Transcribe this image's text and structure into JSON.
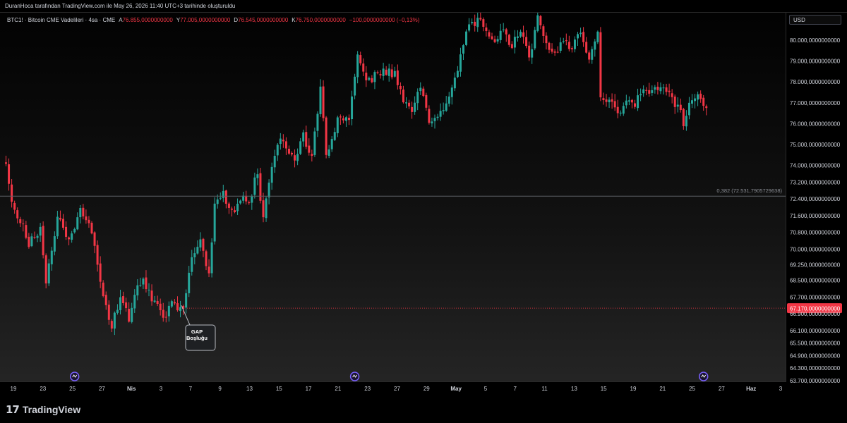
{
  "attribution": "DuranHoca tarafından TradingView.com ile May 26, 2026 11:40 UTC+3 tarihinde oluşturuldu",
  "legend": {
    "symbol": "BTC1! · Bitcoin CME Vadelileri · 4sa · CME",
    "o_label": "A",
    "o_value": "76.855,0000000000",
    "h_label": "Y",
    "h_value": "77.005,0000000000",
    "l_label": "D",
    "l_value": "76.545,0000000000",
    "c_label": "K",
    "c_value": "76.750,0000000000",
    "change": "−100,0000000000 (−0,13%)"
  },
  "currency": "USD",
  "branding": {
    "mark": "17",
    "name": "TradingView"
  },
  "colors": {
    "up": "#26a69a",
    "down": "#f23645",
    "text": "#d1d4dc",
    "fib_line": "#5d6066",
    "price_badge": "#f23645",
    "event_icon": "#7b61ff"
  },
  "chart_data": {
    "type": "candlestick",
    "ylim": [
      63700,
      80400
    ],
    "price_ticks": [
      {
        "value": 80000,
        "label": "80.000,0000000000"
      },
      {
        "value": 79000,
        "label": "79.000,0000000000"
      },
      {
        "value": 78000,
        "label": "78.000,0000000000"
      },
      {
        "value": 77000,
        "label": "77.000,0000000000"
      },
      {
        "value": 76000,
        "label": "76.000,0000000000"
      },
      {
        "value": 75000,
        "label": "75.000,0000000000"
      },
      {
        "value": 74000,
        "label": "74.000,0000000000"
      },
      {
        "value": 73200,
        "label": "73.200,0000000000"
      },
      {
        "value": 72400,
        "label": "72.400,0000000000"
      },
      {
        "value": 71600,
        "label": "71.600,0000000000"
      },
      {
        "value": 70800,
        "label": "70.800,0000000000"
      },
      {
        "value": 70000,
        "label": "70.000,0000000000"
      },
      {
        "value": 69250,
        "label": "69.250,0000000000"
      },
      {
        "value": 68500,
        "label": "68.500,0000000000"
      },
      {
        "value": 67700,
        "label": "67.700,0000000000"
      },
      {
        "value": 66900,
        "label": "66.900,0000000000"
      },
      {
        "value": 66100,
        "label": "66.100,0000000000"
      },
      {
        "value": 65500,
        "label": "65.500,0000000000"
      },
      {
        "value": 64900,
        "label": "64.900,0000000000"
      },
      {
        "value": 64300,
        "label": "64.300,0000000000"
      },
      {
        "value": 63700,
        "label": "63.700,0000000000"
      }
    ],
    "date_ticks": [
      "19",
      "23",
      "25",
      "27",
      "Nis",
      "3",
      "7",
      "9",
      "13",
      "15",
      "17",
      "21",
      "23",
      "27",
      "29",
      "May",
      "5",
      "7",
      "11",
      "13",
      "15",
      "19",
      "21",
      "25",
      "27",
      "Haz",
      "3"
    ],
    "current_price": {
      "value": 67170,
      "label": "67.170,0000000000"
    },
    "fib_level": {
      "value": 72531.79,
      "label": "0,382 (72.531,7905729638)"
    },
    "annotation": {
      "text": "GAP Boşluğu",
      "anchor_price": 67170
    },
    "event_markers": [
      24,
      122,
      244
    ],
    "path_anchors": [
      [
        0,
        74300
      ],
      [
        2,
        72200
      ],
      [
        5,
        71300
      ],
      [
        8,
        70300
      ],
      [
        12,
        70900
      ],
      [
        14,
        68300
      ],
      [
        18,
        71500
      ],
      [
        22,
        70300
      ],
      [
        26,
        72000
      ],
      [
        30,
        70800
      ],
      [
        33,
        68300
      ],
      [
        37,
        66300
      ],
      [
        40,
        67600
      ],
      [
        43,
        66700
      ],
      [
        46,
        68200
      ],
      [
        48,
        68600
      ],
      [
        52,
        67400
      ],
      [
        55,
        66700
      ],
      [
        58,
        67300
      ],
      [
        62,
        67200
      ],
      [
        65,
        69700
      ],
      [
        68,
        70300
      ],
      [
        71,
        68800
      ],
      [
        73,
        72000
      ],
      [
        76,
        72600
      ],
      [
        79,
        71700
      ],
      [
        82,
        72400
      ],
      [
        85,
        72200
      ],
      [
        88,
        73700
      ],
      [
        90,
        71300
      ],
      [
        92,
        73400
      ],
      [
        95,
        75200
      ],
      [
        98,
        74900
      ],
      [
        101,
        74300
      ],
      [
        104,
        75400
      ],
      [
        107,
        74400
      ],
      [
        110,
        77700
      ],
      [
        112,
        74400
      ],
      [
        116,
        76100
      ],
      [
        120,
        76400
      ],
      [
        123,
        79200
      ],
      [
        126,
        78100
      ],
      [
        130,
        78300
      ],
      [
        133,
        78500
      ],
      [
        136,
        78400
      ],
      [
        139,
        77200
      ],
      [
        142,
        76700
      ],
      [
        145,
        77800
      ],
      [
        148,
        76000
      ],
      [
        151,
        76300
      ],
      [
        154,
        76800
      ],
      [
        157,
        78000
      ],
      [
        160,
        79800
      ],
      [
        162,
        80600
      ],
      [
        165,
        81000
      ],
      [
        168,
        80500
      ],
      [
        171,
        79900
      ],
      [
        174,
        80500
      ],
      [
        177,
        79600
      ],
      [
        180,
        80600
      ],
      [
        183,
        79000
      ],
      [
        186,
        81000
      ],
      [
        189,
        79900
      ],
      [
        192,
        79200
      ],
      [
        195,
        80100
      ],
      [
        198,
        79600
      ],
      [
        201,
        80300
      ],
      [
        204,
        79100
      ],
      [
        207,
        80600
      ],
      [
        208,
        77200
      ],
      [
        211,
        77100
      ],
      [
        214,
        76600
      ],
      [
        217,
        77000
      ],
      [
        220,
        76900
      ],
      [
        223,
        77700
      ],
      [
        226,
        77500
      ],
      [
        229,
        77900
      ],
      [
        232,
        77400
      ],
      [
        235,
        76800
      ],
      [
        237,
        76100
      ],
      [
        239,
        77000
      ],
      [
        242,
        77500
      ],
      [
        245,
        76750
      ]
    ]
  }
}
